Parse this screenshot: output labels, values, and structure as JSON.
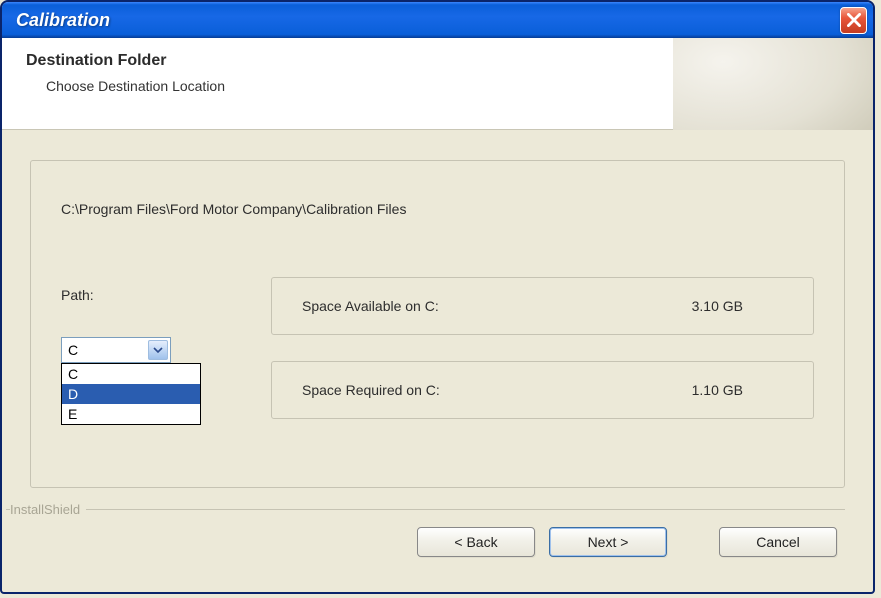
{
  "window": {
    "title": "Calibration"
  },
  "header": {
    "title": "Destination Folder",
    "subtitle": "Choose Destination Location"
  },
  "destination": {
    "path_text": "C:\\Program Files\\Ford Motor Company\\Calibration Files",
    "path_label": "Path:",
    "selected_drive": "C",
    "drive_options": [
      "C",
      "D",
      "E"
    ],
    "highlighted_option": "D"
  },
  "space": {
    "available_label": "Space Available on C:",
    "available_value": "3.10 GB",
    "required_label": "Space Required on C:",
    "required_value": "1.10 GB"
  },
  "brand": "InstallShield",
  "buttons": {
    "back": "< Back",
    "next": "Next >",
    "cancel": "Cancel"
  }
}
